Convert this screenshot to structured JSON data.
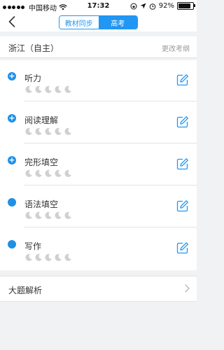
{
  "status_bar": {
    "carrier": "中国移动",
    "time": "17:32",
    "battery_percent": "92%",
    "battery_level": 0.92
  },
  "navbar": {
    "tabs": [
      {
        "label": "教材同步",
        "active": false
      },
      {
        "label": "高考",
        "active": true
      }
    ]
  },
  "region": {
    "name": "浙江（自主）",
    "change_label": "更改考纲"
  },
  "sections": [
    {
      "title": "听力",
      "marker": "plus",
      "filled_stars": 0,
      "total_stars": 5
    },
    {
      "title": "阅读理解",
      "marker": "plus",
      "filled_stars": 0,
      "total_stars": 5
    },
    {
      "title": "完形填空",
      "marker": "plus",
      "filled_stars": 0,
      "total_stars": 5
    },
    {
      "title": "语法填空",
      "marker": "dot",
      "filled_stars": 0,
      "total_stars": 5
    },
    {
      "title": "写作",
      "marker": "dot",
      "filled_stars": 0,
      "total_stars": 5
    }
  ],
  "big_question": {
    "label": "大题解析"
  },
  "colors": {
    "accent": "#2196f3",
    "marker": "#1e90e8",
    "background": "#f1f2f4",
    "moon": "#d0d0d0"
  },
  "icons": {
    "back": "chevron-left-icon",
    "edit": "edit-icon",
    "star": "moon-icon",
    "next": "chevron-right-icon"
  }
}
